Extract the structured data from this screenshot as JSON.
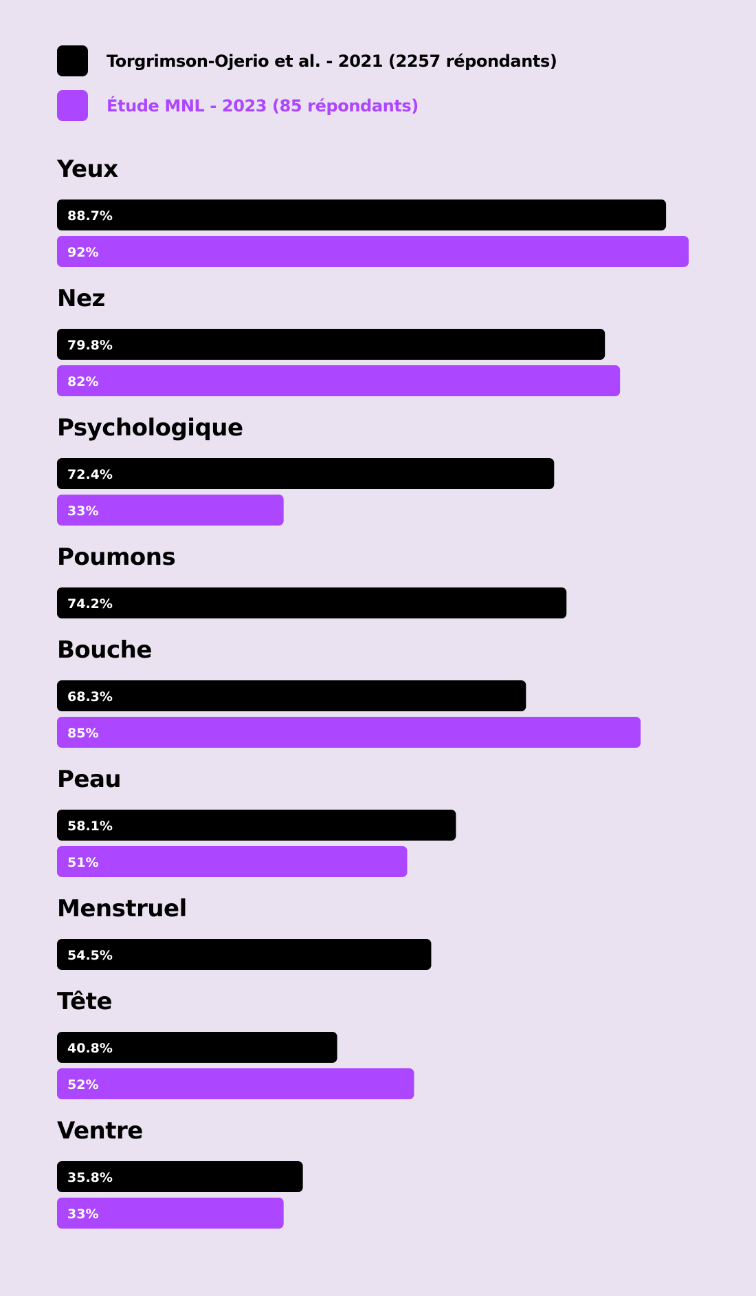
{
  "chart_data": {
    "type": "bar",
    "orientation": "horizontal",
    "xlim": [
      0,
      100
    ],
    "legend_position": "top-left",
    "grid": false,
    "series": [
      {
        "name": "Torgrimson-Ojerio et al. - 2021 (2257 répondants)",
        "color": "#000000",
        "values": [
          88.7,
          79.8,
          72.4,
          74.2,
          68.3,
          58.1,
          54.5,
          40.8,
          35.8
        ],
        "labels": [
          "88.7%",
          "79.8%",
          "72.4%",
          "74.2%",
          "68.3%",
          "58.1%",
          "54.5%",
          "40.8%",
          "35.8%"
        ]
      },
      {
        "name": "Étude MNL - 2023 (85 répondants)",
        "color": "#ad46ff",
        "values": [
          92,
          82,
          33,
          null,
          85,
          51,
          null,
          52,
          33
        ],
        "labels": [
          "92%",
          "82%",
          "33%",
          null,
          "85%",
          "51%",
          null,
          "52%",
          "33%"
        ]
      }
    ],
    "categories": [
      "Yeux",
      "Nez",
      "Psychologique",
      "Poumons",
      "Bouche",
      "Peau",
      "Menstruel",
      "Tête",
      "Ventre"
    ]
  }
}
